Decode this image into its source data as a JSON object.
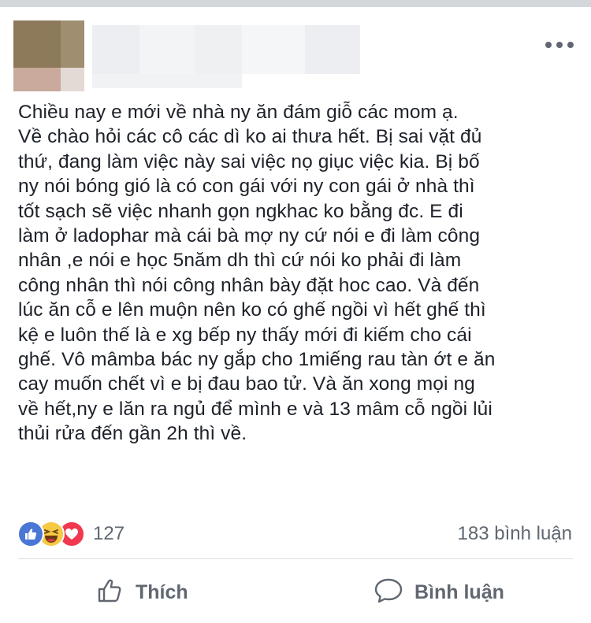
{
  "header": {
    "avatar_icon": "avatar-icon",
    "more_icon": "more-options-icon"
  },
  "post": {
    "text": "Chiều nay e mới về nhà ny ăn đám giỗ các mom ạ.\nVề chào hỏi các cô các dì ko ai thưa hết. Bị sai vặt đủ\nthứ, đang làm việc này sai việc nọ giục việc kia. Bị bố\nny nói bóng gió là có con gái với ny con gái ở nhà thì\ntốt sạch sẽ việc nhanh gọn ngkhac ko bằng đc. E đi\nlàm ở ladophar mà cái bà mợ ny cứ nói e đi làm công\nnhân ,e nói e học 5năm dh thì cứ nói ko phải đi làm\ncông nhân thì nói công nhân bày đặt hoc cao. Và đến\nlúc ăn cỗ e lên muộn nên ko có ghế ngồi vì hết ghế thì\nkệ e luôn thế là e xg bếp ny thấy mới đi kiếm cho cái\nghế. Vô mâmba bác ny gắp cho 1miếng rau tàn ớt e ăn\ncay muốn chết vì e bị đau bao tử. Và ăn xong mọi ng\nvề hết,ny e lăn ra ngủ để mình e và 13 mâm cỗ ngồi lủi\nthủi rửa đến gần 2h thì về."
  },
  "reactions": {
    "icons": [
      "like-icon",
      "haha-icon",
      "love-icon"
    ],
    "count": "127",
    "comments": "183 bình luận"
  },
  "actions": {
    "like_label": "Thích",
    "comment_label": "Bình luận"
  },
  "colors": {
    "like_blue": "#4a76d6",
    "haha_yellow": "#f7c843",
    "love_red": "#f0384f",
    "secondary_text": "#606770"
  }
}
